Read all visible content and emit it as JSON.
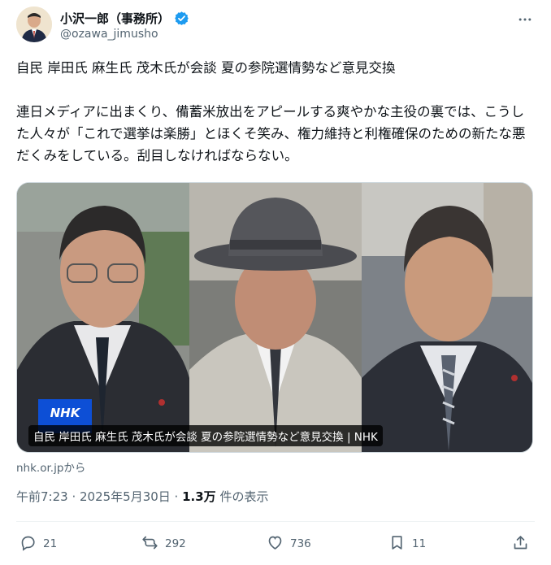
{
  "author": {
    "name": "小沢一郎（事務所）",
    "handle": "@ozawa_jimusho"
  },
  "tweet": {
    "text": "自民 岸田氏 麻生氏 茂木氏が会談 夏の参院選情勢など意見交換\n\n連日メディアに出まくり、備蓄米放出をアピールする爽やかな主役の裏では、こうした人々が「これで選挙は楽勝」とほくそ笑み、権力維持と利権確保のための新たな悪だくみをしている。刮目しなければならない。"
  },
  "card": {
    "caption": "自民 岸田氏 麻生氏 茂木氏が会談 夏の参院選情勢など意見交換 | NHK",
    "watermark": "NHK",
    "source": "nhk.or.jpから"
  },
  "meta": {
    "time": "午前7:23 · 2025年5月30日 · ",
    "views_count": "1.3万",
    "views_label": " 件の表示"
  },
  "actions": {
    "replies": "21",
    "reposts": "292",
    "likes": "736",
    "bookmarks": "11"
  },
  "icons": {
    "verified": "verified-badge-icon",
    "more": "more-icon",
    "reply": "reply-icon",
    "repost": "repost-icon",
    "like": "heart-icon",
    "bookmark": "bookmark-icon",
    "share": "share-icon"
  },
  "colors": {
    "text": "#0f1419",
    "secondary": "#536471",
    "verified": "#1d9bf0",
    "divider": "#eff3f4"
  }
}
